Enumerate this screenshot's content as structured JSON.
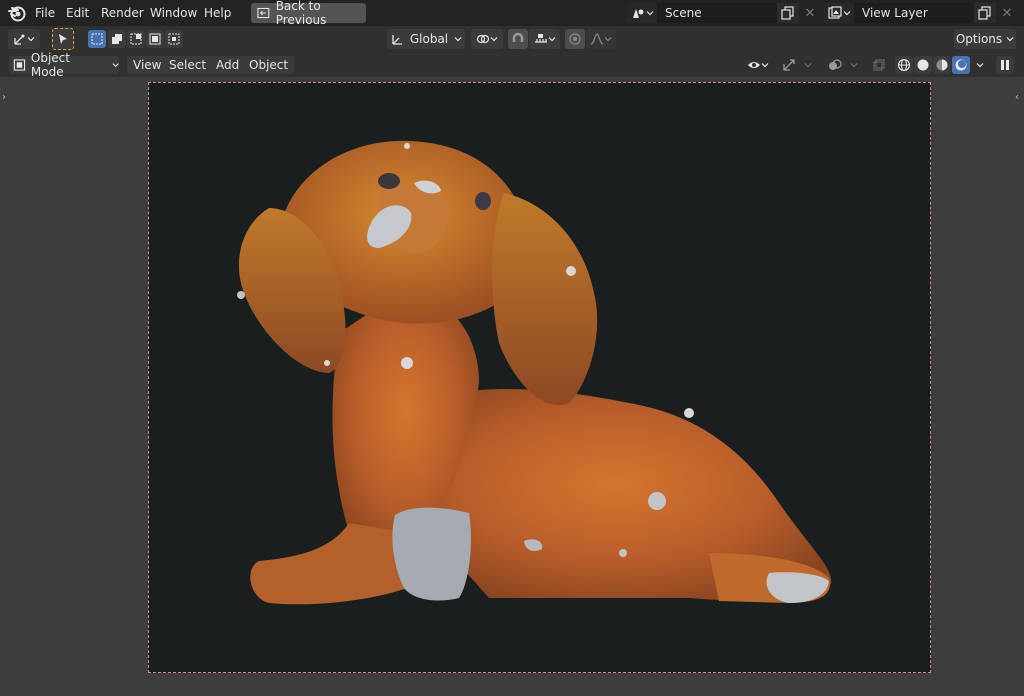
{
  "topbar": {
    "menu": [
      "File",
      "Edit",
      "Render",
      "Window",
      "Help"
    ],
    "back_label": "Back to Previous",
    "scene": {
      "value": "Scene"
    },
    "view_layer": {
      "value": "View Layer"
    }
  },
  "header": {
    "orientation": "Global",
    "options_label": "Options"
  },
  "header2": {
    "mode_label": "Object Mode",
    "menus": [
      "View",
      "Select",
      "Add",
      "Object"
    ]
  },
  "viewport": {
    "subject": "dog-figurine-render",
    "background": "#191f1f"
  },
  "colors": {
    "accent": "#4772b3",
    "topbar": "#232323",
    "header": "#303030",
    "figurine_orange": "#c8702a"
  }
}
